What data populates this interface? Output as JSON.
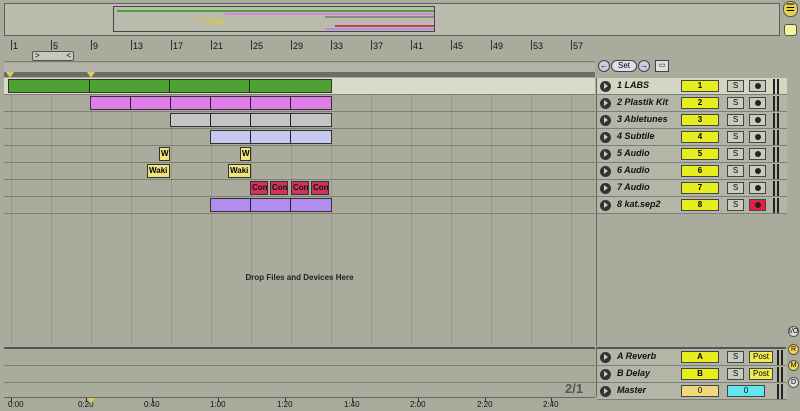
{
  "ruler": {
    "bars": [
      "1",
      "5",
      "9",
      "13",
      "17",
      "21",
      "25",
      "29",
      "33",
      "37",
      "41",
      "45",
      "49",
      "53",
      "57"
    ],
    "loop_left": ">",
    "loop_right": "<"
  },
  "controls": {
    "set_label": "Set",
    "nav_left": "←",
    "nav_right": "→"
  },
  "tracks": [
    {
      "name": "1 LABS",
      "number": "1",
      "solo": "S",
      "armed": false,
      "color": "#4ea234",
      "selected": true
    },
    {
      "name": "2 Plastik Kit",
      "number": "2",
      "solo": "S",
      "armed": false,
      "color": "#e07ee9",
      "selected": false
    },
    {
      "name": "3 Abletunes",
      "number": "3",
      "solo": "S",
      "armed": false,
      "color": "#c3c5c5",
      "selected": false
    },
    {
      "name": "4 Subtile",
      "number": "4",
      "solo": "S",
      "armed": false,
      "color": "#c6c9ef",
      "selected": false
    },
    {
      "name": "5 Audio",
      "number": "5",
      "solo": "S",
      "armed": false,
      "color": "#efe380",
      "selected": false
    },
    {
      "name": "6 Audio",
      "number": "6",
      "solo": "S",
      "armed": false,
      "color": "#efe380",
      "selected": false
    },
    {
      "name": "7 Audio",
      "number": "7",
      "solo": "S",
      "armed": false,
      "color": "#d0345c",
      "selected": false
    },
    {
      "name": "8 kat.sep2",
      "number": "8",
      "solo": "S",
      "armed": true,
      "color": "#b38cf0",
      "selected": false
    }
  ],
  "clip_labels": {
    "w_short": "W",
    "waki": "Waki",
    "con": "Con"
  },
  "drop_text": "Drop Files and Devices Here",
  "returns": [
    {
      "name": "A Reverb",
      "letter": "A",
      "solo": "S",
      "post": "Post"
    },
    {
      "name": "B Delay",
      "letter": "B",
      "solo": "S",
      "post": "Post"
    }
  ],
  "master": {
    "name": "Master",
    "volume": "0",
    "pan": "0"
  },
  "page_counter": "2/1",
  "time_labels": [
    "0:00",
    "0:20",
    "0:40",
    "1:00",
    "1:20",
    "1:40",
    "2:00",
    "2:20",
    "2:40"
  ],
  "side_buttons": [
    "I/O",
    "R",
    "M",
    "D"
  ],
  "colors": {
    "background": "#a9ab9c",
    "number_box": "#e6ee1e",
    "arm_active": "#e8203c",
    "master_pan": "#64e6ef"
  }
}
